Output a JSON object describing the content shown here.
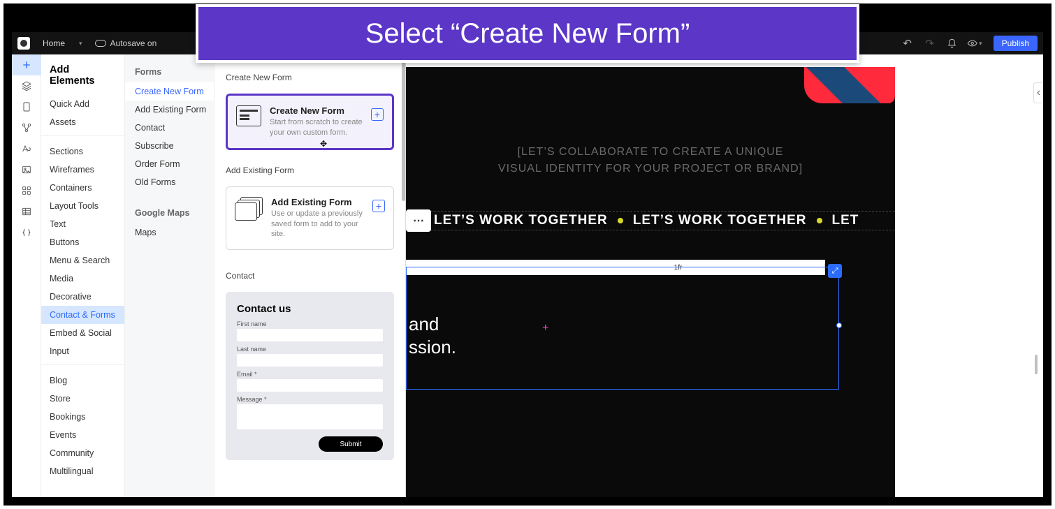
{
  "tutorial_text": "Select “Create New Form”",
  "topbar": {
    "home_label": "Home",
    "autosave_label": "Autosave on",
    "publish_label": "Publish"
  },
  "panel_title": "Add Elements",
  "categories_a": [
    {
      "label": "Quick Add"
    },
    {
      "label": "Assets"
    }
  ],
  "categories_b": [
    {
      "label": "Sections"
    },
    {
      "label": "Wireframes"
    },
    {
      "label": "Containers"
    },
    {
      "label": "Layout Tools"
    },
    {
      "label": "Text"
    },
    {
      "label": "Buttons"
    },
    {
      "label": "Menu & Search"
    },
    {
      "label": "Media"
    },
    {
      "label": "Decorative"
    },
    {
      "label": "Contact & Forms"
    },
    {
      "label": "Embed & Social"
    },
    {
      "label": "Input"
    }
  ],
  "categories_c": [
    {
      "label": "Blog"
    },
    {
      "label": "Store"
    },
    {
      "label": "Bookings"
    },
    {
      "label": "Events"
    },
    {
      "label": "Community"
    },
    {
      "label": "Multilingual"
    }
  ],
  "groups": {
    "forms_label": "Forms",
    "forms_items": [
      {
        "label": "Create New Form"
      },
      {
        "label": "Add Existing Form"
      },
      {
        "label": "Contact"
      },
      {
        "label": "Subscribe"
      },
      {
        "label": "Order Form"
      },
      {
        "label": "Old Forms"
      }
    ],
    "maps_label": "Google Maps",
    "maps_items": [
      {
        "label": "Maps"
      }
    ]
  },
  "sections": {
    "create_new": {
      "heading": "Create New Form",
      "card_title": "Create New Form",
      "card_desc": "Start from scratch to create your own custom form."
    },
    "add_existing": {
      "heading": "Add Existing Form",
      "card_title": "Add Existing Form",
      "card_desc": "Use or update a previously saved form to add to your site."
    },
    "contact": {
      "heading": "Contact",
      "form_title": "Contact us",
      "first_name": "First name",
      "last_name": "Last name",
      "email": "Email *",
      "message": "Message *",
      "submit": "Submit"
    }
  },
  "canvas": {
    "hero_line1": "[LET’S COLLABORATE TO CREATE A UNIQUE",
    "hero_line2": "VISUAL IDENTITY FOR YOUR PROJECT OR BRAND]",
    "marquee_text": "LET’S WORK TOGETHER",
    "marquee_text_cut": "LET",
    "ruler_unit": "1fr",
    "body_line1": "and",
    "body_line2": "ssion.",
    "ellipsis": "⋯"
  }
}
